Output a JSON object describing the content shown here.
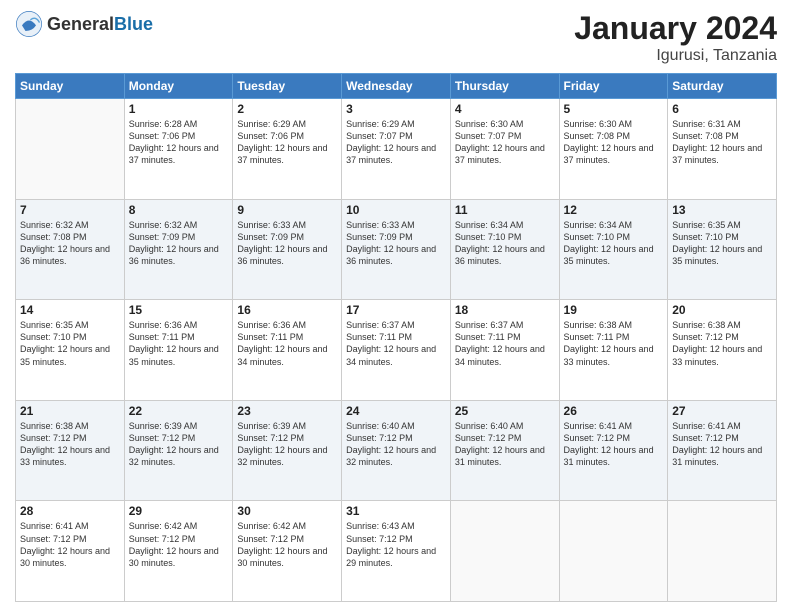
{
  "header": {
    "logo": {
      "general": "General",
      "blue": "Blue"
    },
    "title": "January 2024",
    "location": "Igurusi, Tanzania"
  },
  "weekdays": [
    "Sunday",
    "Monday",
    "Tuesday",
    "Wednesday",
    "Thursday",
    "Friday",
    "Saturday"
  ],
  "weeks": [
    [
      {
        "day": "",
        "sunrise": "",
        "sunset": "",
        "daylight": "",
        "empty": true
      },
      {
        "day": "1",
        "sunrise": "Sunrise: 6:28 AM",
        "sunset": "Sunset: 7:06 PM",
        "daylight": "Daylight: 12 hours and 37 minutes."
      },
      {
        "day": "2",
        "sunrise": "Sunrise: 6:29 AM",
        "sunset": "Sunset: 7:06 PM",
        "daylight": "Daylight: 12 hours and 37 minutes."
      },
      {
        "day": "3",
        "sunrise": "Sunrise: 6:29 AM",
        "sunset": "Sunset: 7:07 PM",
        "daylight": "Daylight: 12 hours and 37 minutes."
      },
      {
        "day": "4",
        "sunrise": "Sunrise: 6:30 AM",
        "sunset": "Sunset: 7:07 PM",
        "daylight": "Daylight: 12 hours and 37 minutes."
      },
      {
        "day": "5",
        "sunrise": "Sunrise: 6:30 AM",
        "sunset": "Sunset: 7:08 PM",
        "daylight": "Daylight: 12 hours and 37 minutes."
      },
      {
        "day": "6",
        "sunrise": "Sunrise: 6:31 AM",
        "sunset": "Sunset: 7:08 PM",
        "daylight": "Daylight: 12 hours and 37 minutes."
      }
    ],
    [
      {
        "day": "7",
        "sunrise": "Sunrise: 6:32 AM",
        "sunset": "Sunset: 7:08 PM",
        "daylight": "Daylight: 12 hours and 36 minutes."
      },
      {
        "day": "8",
        "sunrise": "Sunrise: 6:32 AM",
        "sunset": "Sunset: 7:09 PM",
        "daylight": "Daylight: 12 hours and 36 minutes."
      },
      {
        "day": "9",
        "sunrise": "Sunrise: 6:33 AM",
        "sunset": "Sunset: 7:09 PM",
        "daylight": "Daylight: 12 hours and 36 minutes."
      },
      {
        "day": "10",
        "sunrise": "Sunrise: 6:33 AM",
        "sunset": "Sunset: 7:09 PM",
        "daylight": "Daylight: 12 hours and 36 minutes."
      },
      {
        "day": "11",
        "sunrise": "Sunrise: 6:34 AM",
        "sunset": "Sunset: 7:10 PM",
        "daylight": "Daylight: 12 hours and 36 minutes."
      },
      {
        "day": "12",
        "sunrise": "Sunrise: 6:34 AM",
        "sunset": "Sunset: 7:10 PM",
        "daylight": "Daylight: 12 hours and 35 minutes."
      },
      {
        "day": "13",
        "sunrise": "Sunrise: 6:35 AM",
        "sunset": "Sunset: 7:10 PM",
        "daylight": "Daylight: 12 hours and 35 minutes."
      }
    ],
    [
      {
        "day": "14",
        "sunrise": "Sunrise: 6:35 AM",
        "sunset": "Sunset: 7:10 PM",
        "daylight": "Daylight: 12 hours and 35 minutes."
      },
      {
        "day": "15",
        "sunrise": "Sunrise: 6:36 AM",
        "sunset": "Sunset: 7:11 PM",
        "daylight": "Daylight: 12 hours and 35 minutes."
      },
      {
        "day": "16",
        "sunrise": "Sunrise: 6:36 AM",
        "sunset": "Sunset: 7:11 PM",
        "daylight": "Daylight: 12 hours and 34 minutes."
      },
      {
        "day": "17",
        "sunrise": "Sunrise: 6:37 AM",
        "sunset": "Sunset: 7:11 PM",
        "daylight": "Daylight: 12 hours and 34 minutes."
      },
      {
        "day": "18",
        "sunrise": "Sunrise: 6:37 AM",
        "sunset": "Sunset: 7:11 PM",
        "daylight": "Daylight: 12 hours and 34 minutes."
      },
      {
        "day": "19",
        "sunrise": "Sunrise: 6:38 AM",
        "sunset": "Sunset: 7:11 PM",
        "daylight": "Daylight: 12 hours and 33 minutes."
      },
      {
        "day": "20",
        "sunrise": "Sunrise: 6:38 AM",
        "sunset": "Sunset: 7:12 PM",
        "daylight": "Daylight: 12 hours and 33 minutes."
      }
    ],
    [
      {
        "day": "21",
        "sunrise": "Sunrise: 6:38 AM",
        "sunset": "Sunset: 7:12 PM",
        "daylight": "Daylight: 12 hours and 33 minutes."
      },
      {
        "day": "22",
        "sunrise": "Sunrise: 6:39 AM",
        "sunset": "Sunset: 7:12 PM",
        "daylight": "Daylight: 12 hours and 32 minutes."
      },
      {
        "day": "23",
        "sunrise": "Sunrise: 6:39 AM",
        "sunset": "Sunset: 7:12 PM",
        "daylight": "Daylight: 12 hours and 32 minutes."
      },
      {
        "day": "24",
        "sunrise": "Sunrise: 6:40 AM",
        "sunset": "Sunset: 7:12 PM",
        "daylight": "Daylight: 12 hours and 32 minutes."
      },
      {
        "day": "25",
        "sunrise": "Sunrise: 6:40 AM",
        "sunset": "Sunset: 7:12 PM",
        "daylight": "Daylight: 12 hours and 31 minutes."
      },
      {
        "day": "26",
        "sunrise": "Sunrise: 6:41 AM",
        "sunset": "Sunset: 7:12 PM",
        "daylight": "Daylight: 12 hours and 31 minutes."
      },
      {
        "day": "27",
        "sunrise": "Sunrise: 6:41 AM",
        "sunset": "Sunset: 7:12 PM",
        "daylight": "Daylight: 12 hours and 31 minutes."
      }
    ],
    [
      {
        "day": "28",
        "sunrise": "Sunrise: 6:41 AM",
        "sunset": "Sunset: 7:12 PM",
        "daylight": "Daylight: 12 hours and 30 minutes."
      },
      {
        "day": "29",
        "sunrise": "Sunrise: 6:42 AM",
        "sunset": "Sunset: 7:12 PM",
        "daylight": "Daylight: 12 hours and 30 minutes."
      },
      {
        "day": "30",
        "sunrise": "Sunrise: 6:42 AM",
        "sunset": "Sunset: 7:12 PM",
        "daylight": "Daylight: 12 hours and 30 minutes."
      },
      {
        "day": "31",
        "sunrise": "Sunrise: 6:43 AM",
        "sunset": "Sunset: 7:12 PM",
        "daylight": "Daylight: 12 hours and 29 minutes."
      },
      {
        "day": "",
        "sunrise": "",
        "sunset": "",
        "daylight": "",
        "empty": true
      },
      {
        "day": "",
        "sunrise": "",
        "sunset": "",
        "daylight": "",
        "empty": true
      },
      {
        "day": "",
        "sunrise": "",
        "sunset": "",
        "daylight": "",
        "empty": true
      }
    ]
  ]
}
